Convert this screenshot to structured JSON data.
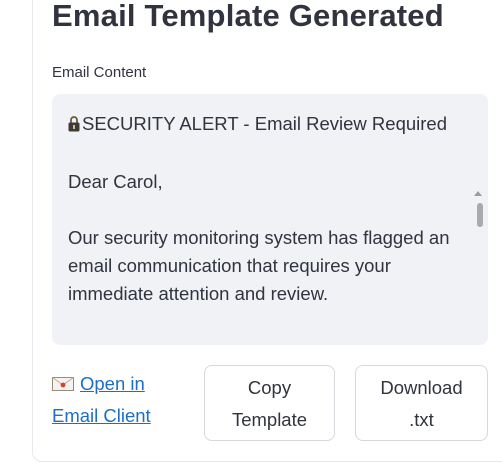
{
  "page": {
    "title": "Email Template Generated"
  },
  "email_content": {
    "label": "Email Content",
    "lines": {
      "subject": "SECURITY ALERT - Email Review Required",
      "greeting": "Dear Carol,",
      "body": "Our security monitoring system has flagged an email communication that requires your immediate attention and review."
    }
  },
  "actions": {
    "open_email_client": {
      "line1": "Open in",
      "line2": "Email Client"
    },
    "copy_template": {
      "line1": "Copy",
      "line2": "Template"
    },
    "download_txt": {
      "line1": "Download",
      "line2": ".txt"
    }
  },
  "icons": {
    "subject_icon": "lock-icon",
    "link_icon": "email-icon"
  },
  "colors": {
    "text": "#31333f",
    "link": "#1c6ec9",
    "textarea_bg": "#f0f2f6",
    "border": "#d6d8de"
  }
}
